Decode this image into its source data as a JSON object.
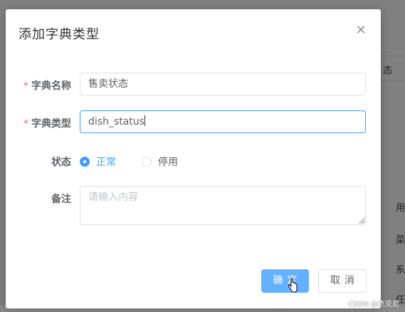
{
  "dialog": {
    "title": "添加字典类型",
    "close_icon": "close-icon"
  },
  "form": {
    "name": {
      "label": "字典名称",
      "required_mark": "*",
      "value": "售卖状态"
    },
    "type": {
      "label": "字典类型",
      "required_mark": "*",
      "value": "dish_status"
    },
    "status": {
      "label": "状态",
      "options": [
        {
          "label": "正常",
          "checked": true
        },
        {
          "label": "停用",
          "checked": false
        }
      ]
    },
    "remark": {
      "label": "备注",
      "placeholder": "请输入内容",
      "value": ""
    }
  },
  "buttons": {
    "confirm": "确定",
    "cancel": "取消"
  },
  "background": {
    "right_labels": [
      "态",
      "用",
      "菜",
      "系",
      "任"
    ]
  },
  "watermark": "CSDN @杰克尼",
  "colors": {
    "primary": "#409eff",
    "primary_hover": "#66b1ff",
    "required": "#f56c6c"
  }
}
